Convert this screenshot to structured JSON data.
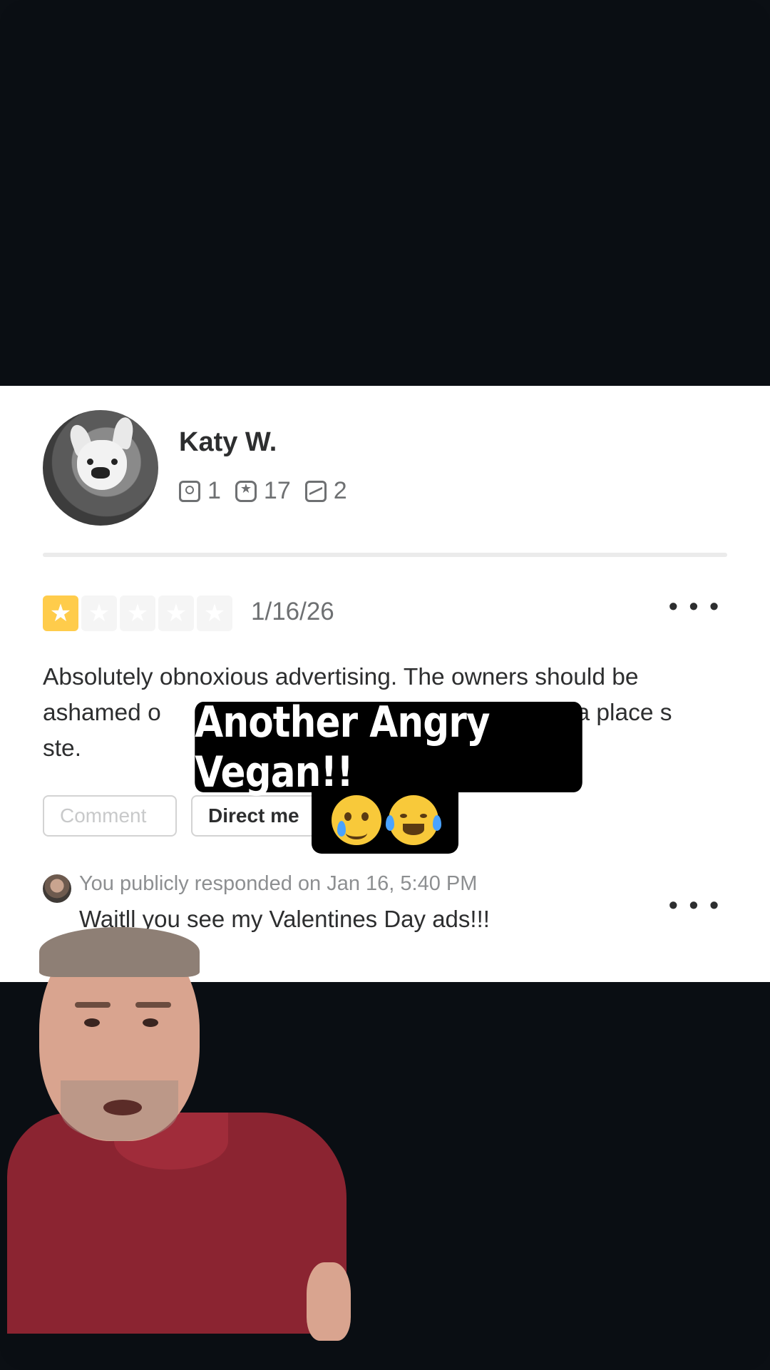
{
  "review": {
    "user_name": "Katy W.",
    "stats": {
      "friends": "1",
      "reviews": "17",
      "photos": "2"
    },
    "rating": 1,
    "rating_max": 5,
    "date": "1/16/26",
    "more_label": "• • •",
    "text": "Absolutely obnoxious advertising. The owners should be ashamed o                                             ting foot in a place s                                              ste.",
    "comment_label": "Comment",
    "direct_label": "Direct me"
  },
  "response": {
    "meta": "You publicly responded on Jan 16, 5:40 PM",
    "text": "Waitll you see my Valentines Day ads!!!",
    "more_label": "• • •"
  },
  "overlay": {
    "caption": "Another Angry Vegan!!"
  },
  "icons": {
    "friends": "friend-icon",
    "reviews": "review-star-icon",
    "photos": "photo-icon",
    "emoji_1": "smiling-face-with-tear",
    "emoji_2": "face-with-tears-of-joy"
  },
  "colors": {
    "star_filled": "#ffcc4b",
    "star_empty": "#f5f5f5",
    "background": "#0a0e13",
    "shirt": "#8b2431"
  }
}
